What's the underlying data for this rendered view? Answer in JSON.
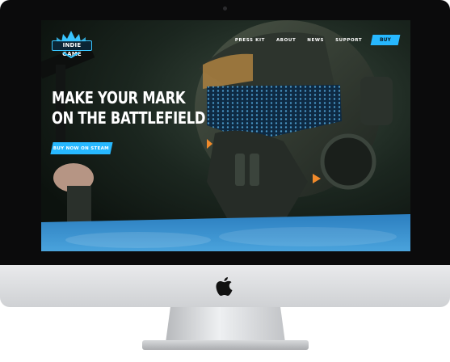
{
  "site": {
    "logo_text": "INDIE GAME",
    "nav": [
      {
        "label": "PRESS KIT"
      },
      {
        "label": "ABOUT"
      },
      {
        "label": "NEWS"
      },
      {
        "label": "SUPPORT"
      }
    ],
    "buy_label": "BUY"
  },
  "hero": {
    "headline_line1": "MAKE YOUR MARK",
    "headline_line2": "ON THE BATTLEFIELD",
    "cta_label": "BUY NOW ON STEAM"
  },
  "colors": {
    "accent": "#27b8ff",
    "monitor_bezel": "#0b0b0c",
    "monitor_chin": "#e2e3e5"
  },
  "icons": [
    "camera-icon",
    "crown-logo-icon",
    "apple-icon"
  ]
}
